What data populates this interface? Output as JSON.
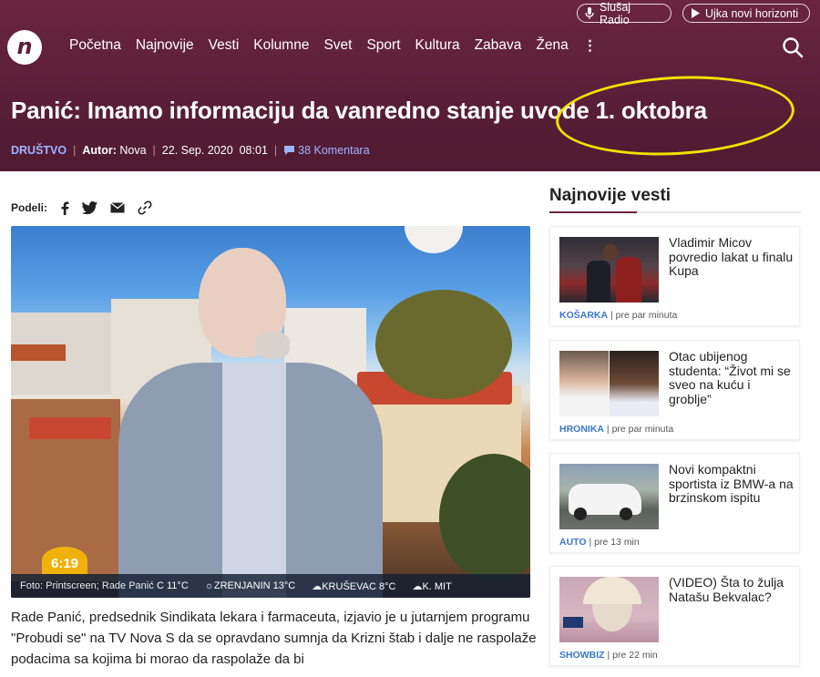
{
  "header": {
    "radio_label": "Slušaj Radio",
    "ujka_label": "Ujka novi horizonti",
    "logo_text": "n",
    "nav": [
      "Početna",
      "Najnovije",
      "Vesti",
      "Kolumne",
      "Svet",
      "Sport",
      "Kultura",
      "Zabava",
      "Žena"
    ],
    "more": "⋮"
  },
  "article": {
    "title": "Panić: Imamo informaciju da vanredno stanje uvode 1. oktobra",
    "category": "DRUŠTVO",
    "author_label": "Autor:",
    "author": "Nova",
    "date": "22. Sep. 2020",
    "time": "08:01",
    "comments": "38 Komentara",
    "share_label": "Podeli:",
    "photo": {
      "credit": "Foto: Printscreen; Rade Panić",
      "ticker": [
        "C 11°C",
        "☼ZRENJANIN 13°C",
        "☁KRUŠEVAC 8°C",
        "☁K. MIT"
      ],
      "clock": "6:19"
    },
    "body": "Rade Panić, predsednik Sindikata lekara i farmaceuta, izjavio je u jutarnjem programu \"Probudi se\" na TV Nova S da se opravdano sumnja da Krizni štab i dalje ne raspolaže podacima sa kojima bi morao da raspolaže da bi"
  },
  "sidebar": {
    "title": "Najnovije vesti",
    "items": [
      {
        "headline": "Vladimir Micov povredio lakat u finalu Kupa",
        "category": "KOŠARKA",
        "time": "pre par minuta"
      },
      {
        "headline": "Otac ubijenog studenta: “Život mi se sveo na kuću i groblje”",
        "category": "HRONIKA",
        "time": "pre par minuta"
      },
      {
        "headline": "Novi kompaktni sportista iz BMW-a na brzinskom ispitu",
        "category": "AUTO",
        "time": "pre 13 min"
      },
      {
        "headline": "(VIDEO) Šta to žulja Natašu Bekvalac?",
        "category": "SHOWBIZ",
        "time": "pre 22 min"
      }
    ]
  },
  "colors": {
    "header_bg": "#5a1f38",
    "accent_blue": "#9fb4ff",
    "highlight_ellipse": "#f2e200",
    "category_blue": "#3a77c9"
  }
}
